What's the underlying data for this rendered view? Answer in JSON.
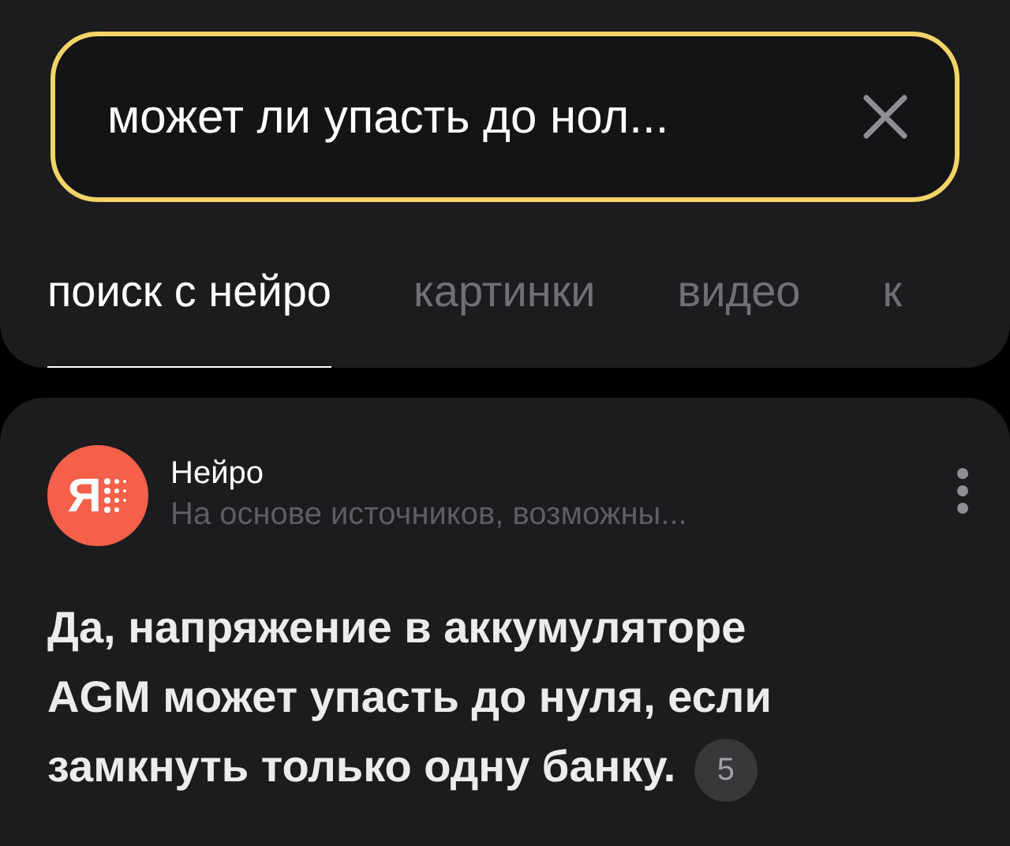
{
  "search": {
    "value": "может ли упасть до нол..."
  },
  "tabs": [
    {
      "label": "поиск с нейро",
      "selected": true
    },
    {
      "label": "картинки",
      "selected": false
    },
    {
      "label": "видео",
      "selected": false
    },
    {
      "label": "к",
      "selected": false
    }
  ],
  "answer_card": {
    "logo_letter": "Я",
    "source_name": "Нейро",
    "source_note": "На основе источников, возможны...",
    "text": "Да, напряжение в аккумуляторе AGM может упасть до нуля, если замкнуть только одну банку.",
    "sources_count": "5"
  }
}
